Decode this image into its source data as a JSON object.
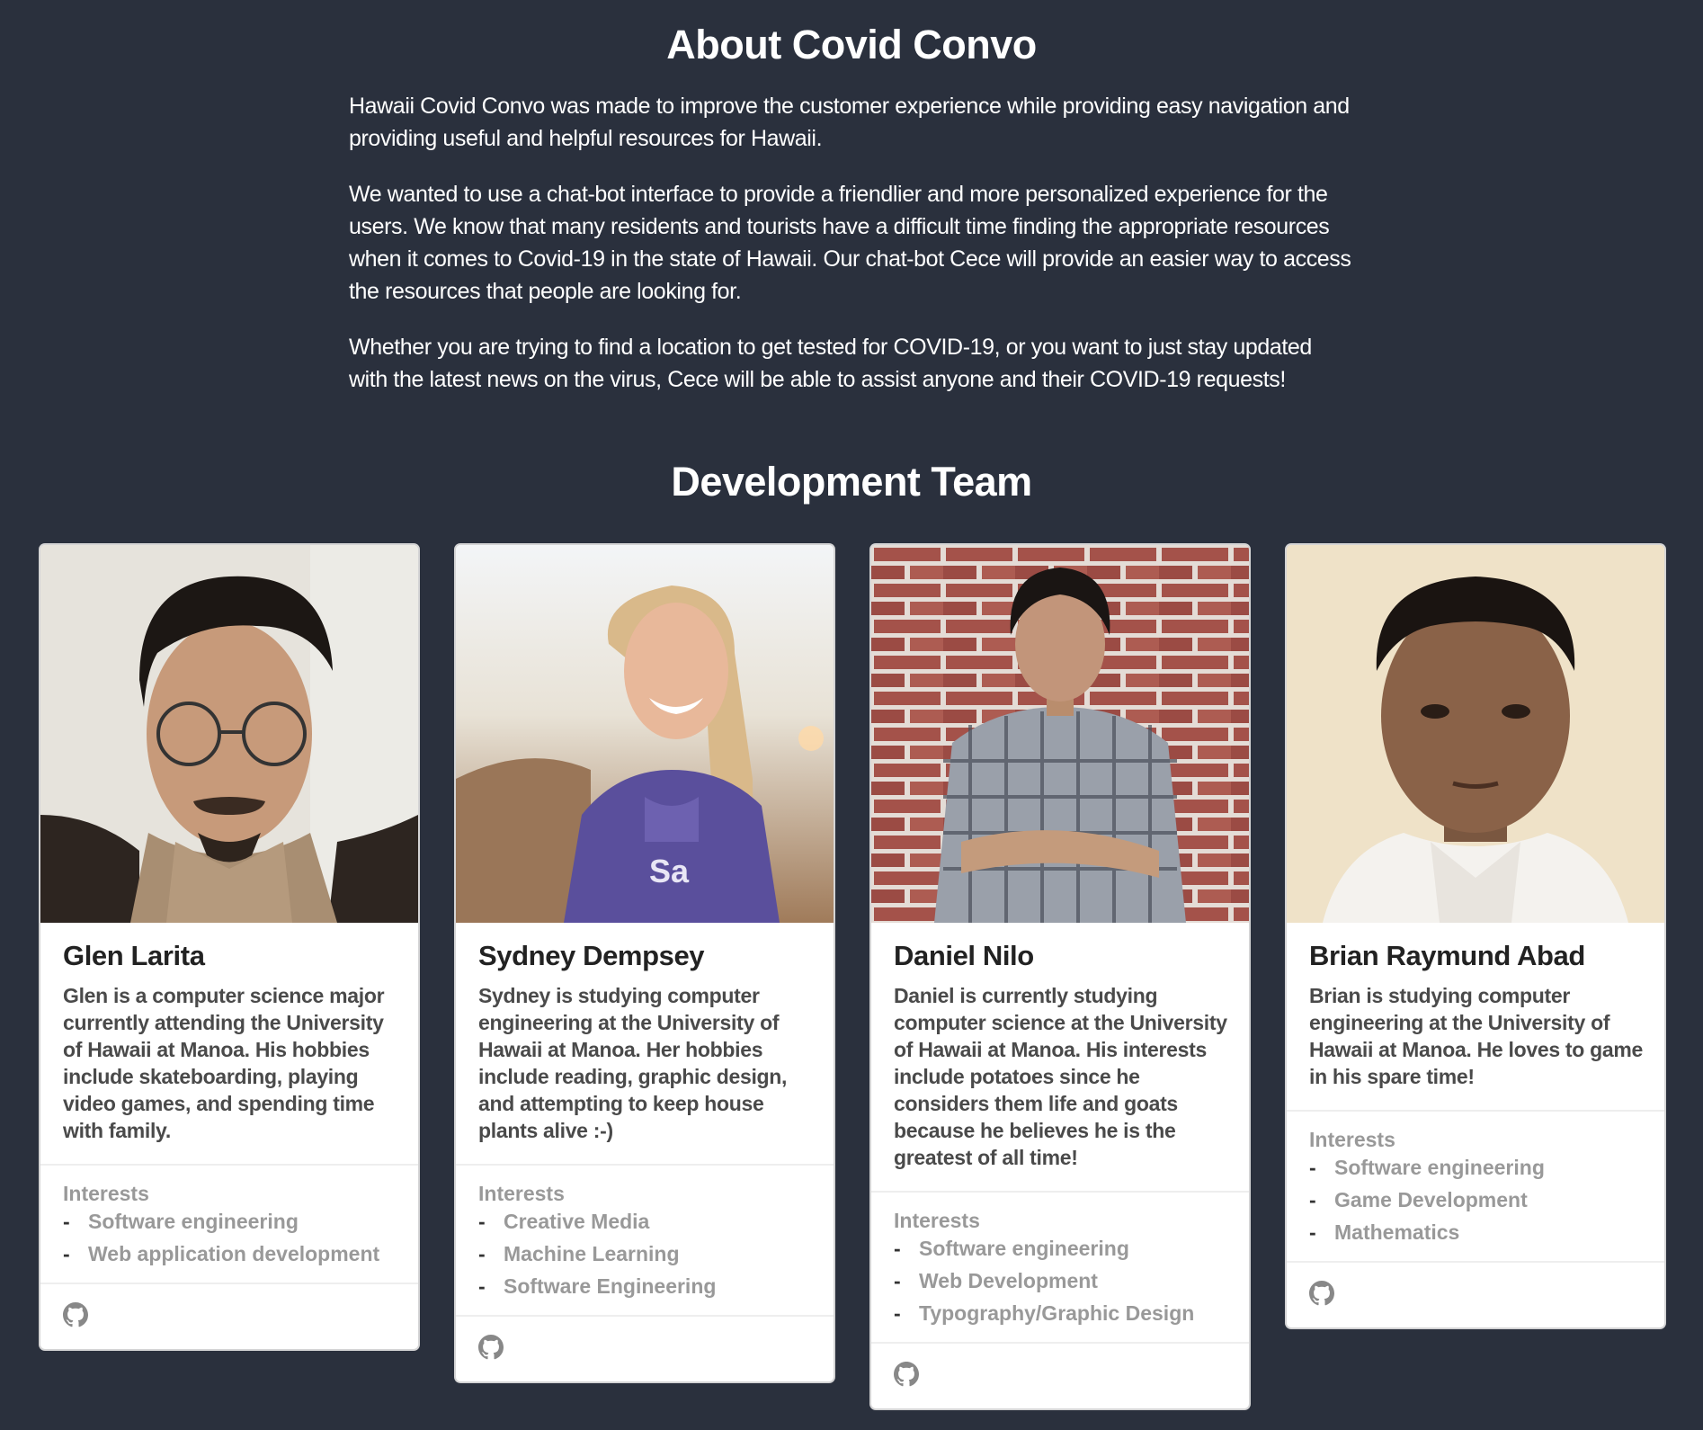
{
  "about": {
    "title": "About Covid Convo",
    "paragraphs": [
      "Hawaii Covid Convo was made to improve the customer experience while providing easy navigation and providing useful and helpful resources for Hawaii.",
      "We wanted to use a chat-bot interface to provide a friendlier and more personalized experience for the users. We know that many residents and tourists have a difficult time finding the appropriate resources when it comes to Covid-19 in the state of Hawaii. Our chat-bot Cece will provide an easier way to access the resources that people are looking for.",
      "Whether you are trying to find a location to get tested for COVID-19, or you want to just stay updated with the latest news on the virus, Cece will be able to assist anyone and their COVID-19 requests!"
    ]
  },
  "team": {
    "title": "Development Team",
    "interests_label": "Interests",
    "members": [
      {
        "name": "Glen Larita",
        "description": "Glen is a computer science major currently attending the University of Hawaii at Manoa. His hobbies include skateboarding, playing video games, and spending time with family.",
        "interests": [
          "Software engineering",
          "Web application development"
        ]
      },
      {
        "name": "Sydney Dempsey",
        "description": "Sydney is studying computer engineering at the University of Hawaii at Manoa. Her hobbies include reading, graphic design, and attempting to keep house plants alive :-)",
        "interests": [
          "Creative Media",
          "Machine Learning",
          "Software Engineering"
        ]
      },
      {
        "name": "Daniel Nilo",
        "description": "Daniel is currently studying computer science at the University of Hawaii at Manoa. His interests include potatoes since he considers them life and goats because he believes he is the greatest of all time!",
        "interests": [
          "Software engineering",
          "Web Development",
          "Typography/Graphic Design"
        ]
      },
      {
        "name": "Brian Raymund Abad",
        "description": "Brian is studying computer engineering at the University of Hawaii at Manoa. He loves to game in his spare time!",
        "interests": [
          "Software engineering",
          "Game Development",
          "Mathematics"
        ]
      }
    ]
  },
  "colors": {
    "background": "#2a303d",
    "card": "#ffffff",
    "muted_text": "#999999"
  }
}
